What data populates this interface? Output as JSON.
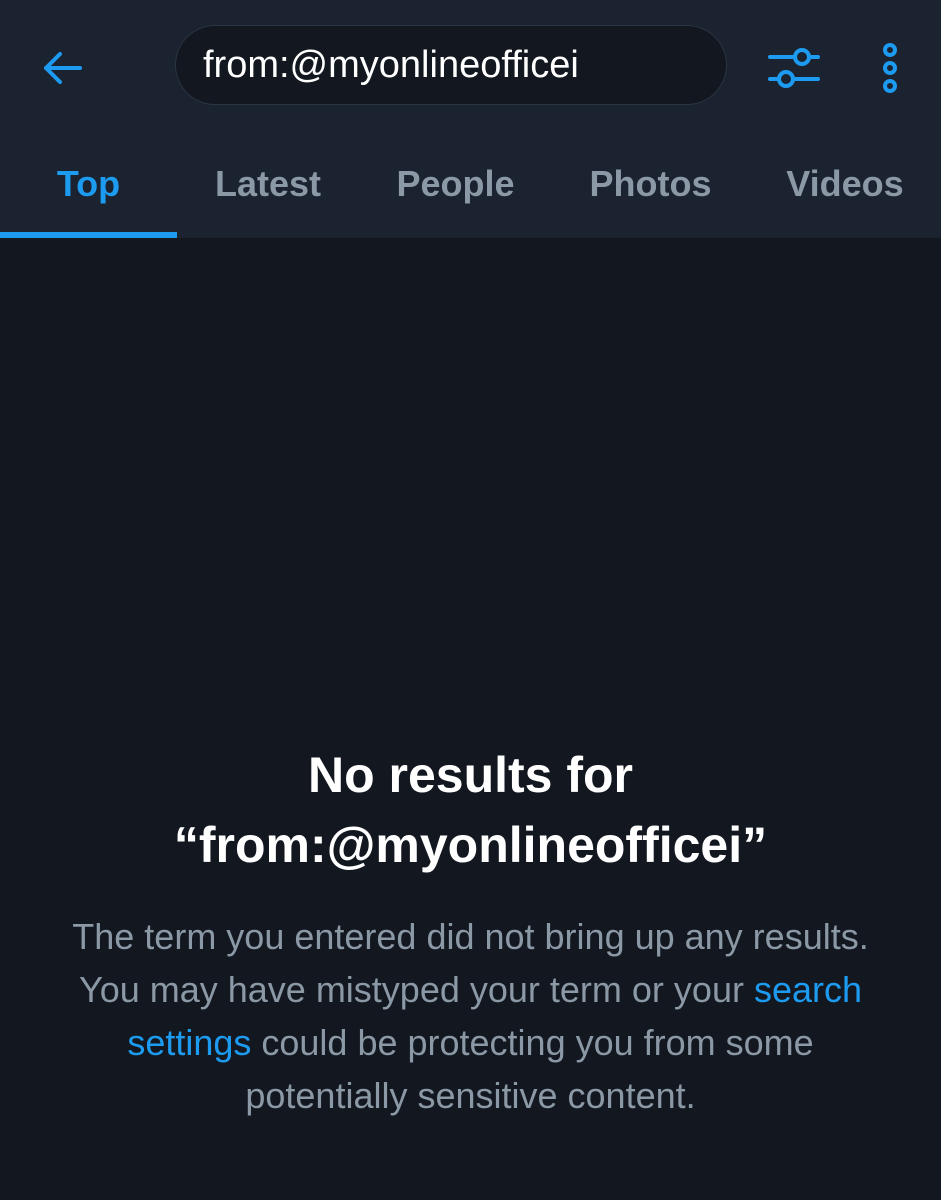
{
  "search": {
    "query": "from:@myonlineofficei"
  },
  "tabs": [
    {
      "label": "Top",
      "active": true
    },
    {
      "label": "Latest",
      "active": false
    },
    {
      "label": "People",
      "active": false
    },
    {
      "label": "Photos",
      "active": false
    },
    {
      "label": "Videos",
      "active": false
    }
  ],
  "empty_state": {
    "title_line1": "No results for",
    "title_line2": "“from:@myonlineofficei”",
    "body_before_link": "The term you entered did not bring up any results. You may have mistyped your term or your ",
    "link_text": "search settings",
    "body_after_link": " could be protecting you from some potentially sensitive content."
  },
  "icons": {
    "back": "arrow-left-icon",
    "filter": "sliders-icon",
    "more": "vertical-dots-icon"
  },
  "colors": {
    "accent": "#1d9bf0",
    "background": "#131820",
    "header_background": "#1b2330",
    "muted_text": "#8b98a5",
    "primary_text": "#ffffff"
  }
}
